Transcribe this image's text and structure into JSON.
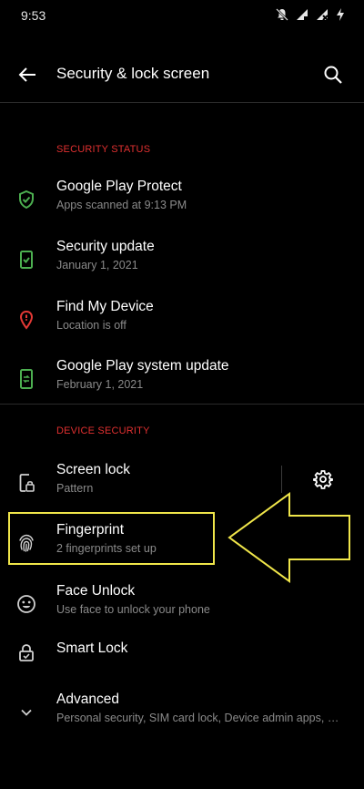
{
  "status_bar": {
    "time": "9:53"
  },
  "header": {
    "title": "Security & lock screen"
  },
  "sections": {
    "security_status": {
      "header": "SECURITY STATUS",
      "items": [
        {
          "title": "Google Play Protect",
          "subtitle": "Apps scanned at 9:13 PM",
          "icon": "shield-check-icon",
          "icon_color": "#4caf50"
        },
        {
          "title": "Security update",
          "subtitle": "January 1, 2021",
          "icon": "phone-check-icon",
          "icon_color": "#4caf50"
        },
        {
          "title": "Find My Device",
          "subtitle": "Location is off",
          "icon": "location-pin-icon",
          "icon_color": "#e53935"
        },
        {
          "title": "Google Play system update",
          "subtitle": "February 1, 2021",
          "icon": "phone-sync-icon",
          "icon_color": "#4caf50"
        }
      ]
    },
    "device_security": {
      "header": "DEVICE SECURITY",
      "items": [
        {
          "title": "Screen lock",
          "subtitle": "Pattern",
          "icon": "phone-lock-icon"
        },
        {
          "title": "Fingerprint",
          "subtitle": "2 fingerprints set up",
          "icon": "fingerprint-icon"
        },
        {
          "title": "Face Unlock",
          "subtitle": "Use face to unlock your phone",
          "icon": "face-icon"
        },
        {
          "title": "Smart Lock",
          "icon": "smart-lock-icon"
        },
        {
          "title": "Advanced",
          "subtitle": "Personal security, SIM card lock, Device admin apps, En..",
          "icon": "chevron-down-icon"
        }
      ]
    }
  },
  "colors": {
    "background": "#000000",
    "accent_red": "#e03030",
    "annotation_yellow": "#f0e64a"
  }
}
